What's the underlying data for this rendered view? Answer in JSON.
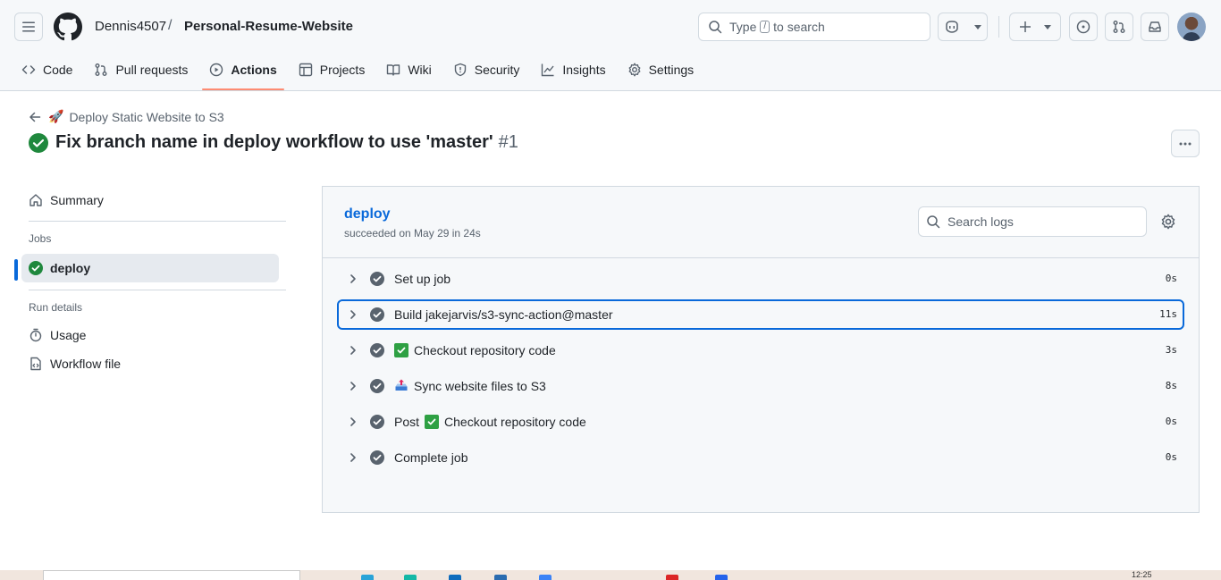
{
  "header": {
    "owner": "Dennis4507",
    "separator": "/",
    "repo": "Personal-Resume-Website",
    "search_prefix": "Type",
    "search_key": "/",
    "search_suffix": "to search"
  },
  "nav": {
    "tabs": [
      {
        "label": "Code",
        "icon": "code-icon"
      },
      {
        "label": "Pull requests",
        "icon": "pull-request-icon"
      },
      {
        "label": "Actions",
        "icon": "play-icon",
        "selected": true
      },
      {
        "label": "Projects",
        "icon": "table-icon"
      },
      {
        "label": "Wiki",
        "icon": "book-icon"
      },
      {
        "label": "Security",
        "icon": "shield-icon"
      },
      {
        "label": "Insights",
        "icon": "graph-icon"
      },
      {
        "label": "Settings",
        "icon": "gear-icon"
      }
    ]
  },
  "run": {
    "workflow_emoji": "🚀",
    "workflow_name": "Deploy Static Website to S3",
    "title": "Fix branch name in deploy workflow to use 'master'",
    "number": "#1"
  },
  "sidebar": {
    "summary": "Summary",
    "jobs_heading": "Jobs",
    "job": "deploy",
    "run_details_heading": "Run details",
    "usage": "Usage",
    "workflow_file": "Workflow file"
  },
  "job": {
    "name": "deploy",
    "status": "succeeded on May 29 in 24s",
    "search_placeholder": "Search logs",
    "steps": [
      {
        "label": "Set up job",
        "duration": "0s"
      },
      {
        "label": "Build jakejarvis/s3-sync-action@master",
        "duration": "11s"
      },
      {
        "label": "Checkout repository code",
        "duration": "3s",
        "emoji": "check-box"
      },
      {
        "label": "Sync website files to S3",
        "duration": "8s",
        "emoji": "outbox-tray"
      },
      {
        "label": "Checkout repository code",
        "duration": "0s",
        "prefix": "Post",
        "emoji": "check-box"
      },
      {
        "label": "Complete job",
        "duration": "0s"
      }
    ]
  },
  "taskbar": {
    "clock": "12:25"
  },
  "colors": {
    "success": "#1f883d",
    "link": "#0969da",
    "selected_tab_underline": "#fd8c73",
    "step_check": "#59636e"
  }
}
